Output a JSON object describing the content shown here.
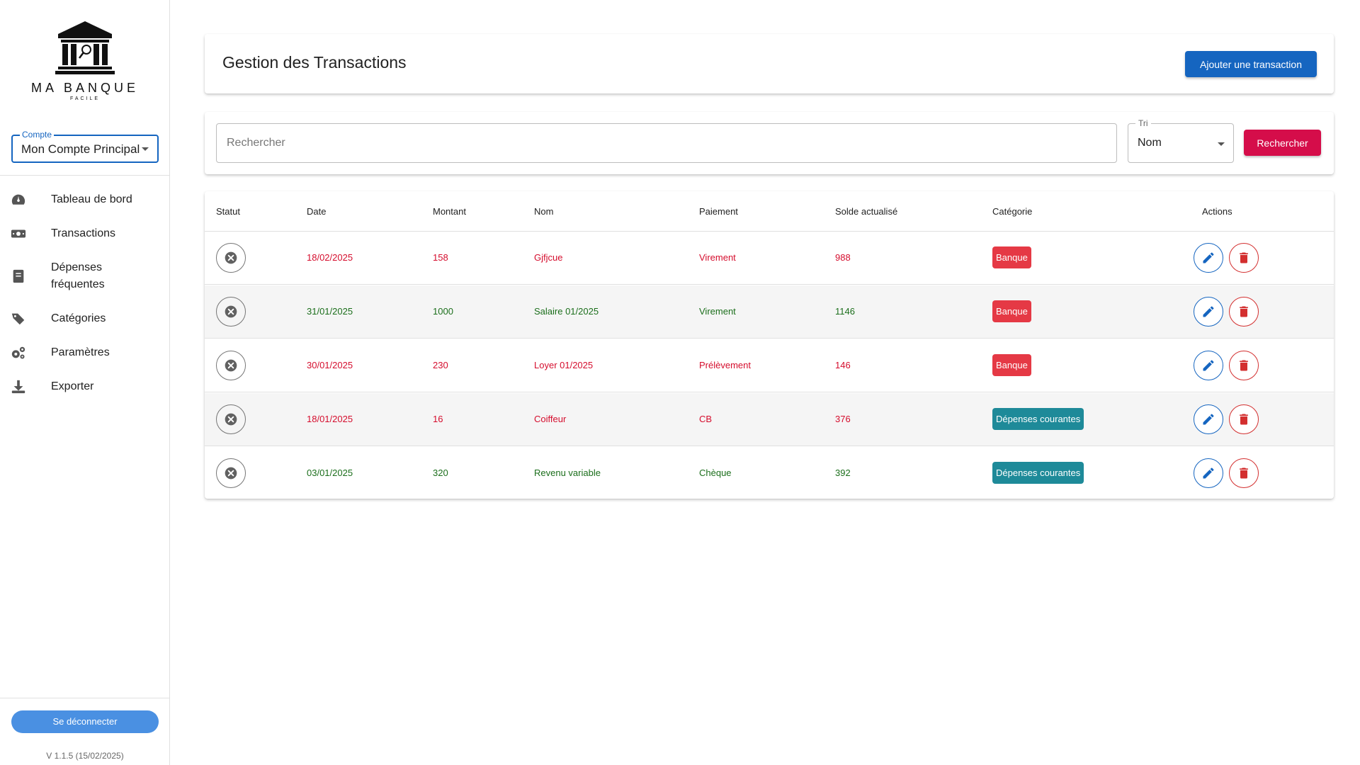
{
  "brand": {
    "name": "MA BANQUE",
    "tagline": "FACILE"
  },
  "account": {
    "label": "Compte",
    "value": "Mon Compte Principal"
  },
  "nav": [
    {
      "icon": "dashboard-icon",
      "label": "Tableau de bord"
    },
    {
      "icon": "money-icon",
      "label": "Transactions"
    },
    {
      "icon": "book-icon",
      "label": "Dépenses fréquentes"
    },
    {
      "icon": "tags-icon",
      "label": "Catégories"
    },
    {
      "icon": "settings-icon",
      "label": "Paramètres"
    },
    {
      "icon": "download-icon",
      "label": "Exporter"
    }
  ],
  "logout_label": "Se déconnecter",
  "version": "V 1.1.5 (15/02/2025)",
  "page_title": "Gestion des Transactions",
  "add_label": "Ajouter une transaction",
  "search": {
    "placeholder": "Rechercher",
    "sort_label": "Tri",
    "sort_value": "Nom",
    "button": "Rechercher"
  },
  "table": {
    "headers": [
      "Statut",
      "Date",
      "Montant",
      "Nom",
      "Paiement",
      "Solde actualisé",
      "Catégorie",
      "Actions"
    ],
    "rows": [
      {
        "date": "18/02/2025",
        "montant": "158",
        "nom": "Gjfjcue",
        "paiement": "Virement",
        "solde": "988",
        "categorie": "Banque",
        "type": "debit"
      },
      {
        "date": "31/01/2025",
        "montant": "1000",
        "nom": "Salaire 01/2025",
        "paiement": "Virement",
        "solde": "1146",
        "categorie": "Banque",
        "type": "credit"
      },
      {
        "date": "30/01/2025",
        "montant": "230",
        "nom": "Loyer 01/2025",
        "paiement": "Prélèvement",
        "solde": "146",
        "categorie": "Banque",
        "type": "debit"
      },
      {
        "date": "18/01/2025",
        "montant": "16",
        "nom": "Coiffeur",
        "paiement": "CB",
        "solde": "376",
        "categorie": "Dépenses courantes",
        "type": "debit"
      },
      {
        "date": "03/01/2025",
        "montant": "320",
        "nom": "Revenu variable",
        "paiement": "Chèque",
        "solde": "392",
        "categorie": "Dépenses courantes",
        "type": "credit"
      }
    ]
  },
  "colors": {
    "primary": "#1565c0",
    "accent": "#d50d4a",
    "debit": "#d50d2d",
    "credit": "#1b6e1b",
    "badge_banque": "#e53945",
    "badge_depenses": "#1e8a99",
    "logout": "#4a90e2"
  }
}
